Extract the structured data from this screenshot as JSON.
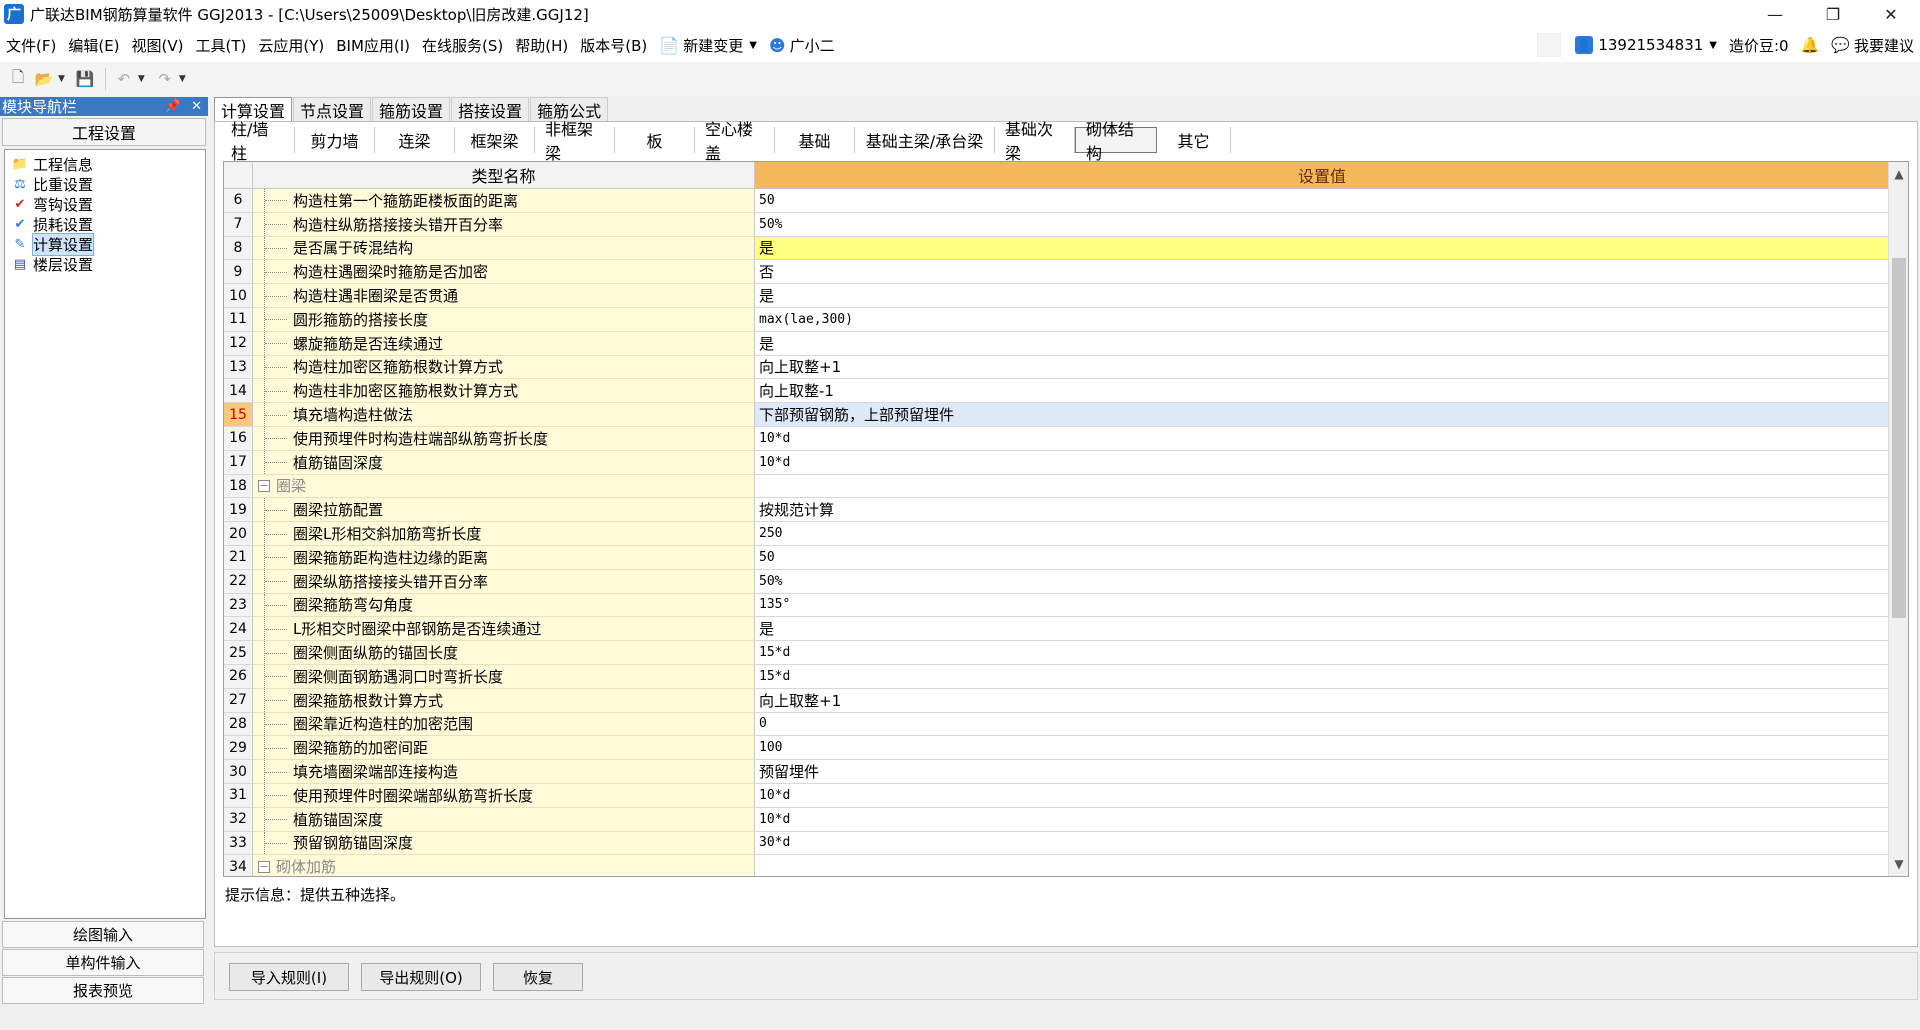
{
  "window": {
    "title": "广联达BIM钢筋算量软件 GGJ2013 - [C:\\Users\\25009\\Desktop\\旧房改建.GGJ12]",
    "app_icon": "广",
    "minimize": "—",
    "restore": "❐",
    "close": "✕"
  },
  "menu": {
    "items": [
      "文件(F)",
      "编辑(E)",
      "视图(V)",
      "工具(T)",
      "云应用(Y)",
      "BIM应用(I)",
      "在线服务(S)",
      "帮助(H)",
      "版本号(B)"
    ],
    "new_change": "新建变更",
    "assistant": "广小二",
    "account": "13921534831",
    "cost_beans": "造价豆:0",
    "feedback": "我要建议"
  },
  "nav": {
    "header": "模块导航栏",
    "section": "工程设置",
    "tree": [
      {
        "label": "工程信息",
        "icon": "folder-icon",
        "glyph": "📁"
      },
      {
        "label": "比重设置",
        "icon": "ratio-icon",
        "glyph": "⚖"
      },
      {
        "label": "弯钩设置",
        "icon": "hook-icon",
        "glyph": "✔"
      },
      {
        "label": "损耗设置",
        "icon": "loss-icon",
        "glyph": "✔"
      },
      {
        "label": "计算设置",
        "icon": "calc-settings-icon",
        "glyph": "✎"
      },
      {
        "label": "楼层设置",
        "icon": "floor-icon",
        "glyph": "▤"
      }
    ],
    "bottom": [
      "绘图输入",
      "单构件输入",
      "报表预览"
    ]
  },
  "tabs_top": [
    "计算设置",
    "节点设置",
    "箍筋设置",
    "搭接设置",
    "箍筋公式"
  ],
  "tabs_sub": [
    "柱/墙柱",
    "剪力墙",
    "连梁",
    "框架梁",
    "非框架梁",
    "板",
    "空心楼盖",
    "基础",
    "基础主梁/承台梁",
    "基础次梁",
    "砌体结构",
    "其它"
  ],
  "grid": {
    "col_name": "类型名称",
    "col_value": "设置值",
    "rows": [
      {
        "num": "6",
        "name": "构造柱第一个箍筋距楼板面的距离",
        "value": "50"
      },
      {
        "num": "7",
        "name": "构造柱纵筋搭接接头错开百分率",
        "value": "50%"
      },
      {
        "num": "8",
        "name": "是否属于砖混结构",
        "value": "是"
      },
      {
        "num": "9",
        "name": "构造柱遇圈梁时箍筋是否加密",
        "value": "否"
      },
      {
        "num": "10",
        "name": "构造柱遇非圈梁是否贯通",
        "value": "是"
      },
      {
        "num": "11",
        "name": "圆形箍筋的搭接长度",
        "value": "max(lae,300)"
      },
      {
        "num": "12",
        "name": "螺旋箍筋是否连续通过",
        "value": "是"
      },
      {
        "num": "13",
        "name": "构造柱加密区箍筋根数计算方式",
        "value": "向上取整+1"
      },
      {
        "num": "14",
        "name": "构造柱非加密区箍筋根数计算方式",
        "value": "向上取整-1"
      },
      {
        "num": "15",
        "name": "填充墙构造柱做法",
        "value": "下部预留钢筋，上部预留埋件"
      },
      {
        "num": "16",
        "name": "使用预埋件时构造柱端部纵筋弯折长度",
        "value": "10*d"
      },
      {
        "num": "17",
        "name": "植筋锚固深度",
        "value": "10*d"
      },
      {
        "num": "18",
        "name": "圈梁",
        "value": ""
      },
      {
        "num": "19",
        "name": "圈梁拉筋配置",
        "value": "按规范计算"
      },
      {
        "num": "20",
        "name": "圈梁L形相交斜加筋弯折长度",
        "value": "250"
      },
      {
        "num": "21",
        "name": "圈梁箍筋距构造柱边缘的距离",
        "value": "50"
      },
      {
        "num": "22",
        "name": "圈梁纵筋搭接接头错开百分率",
        "value": "50%"
      },
      {
        "num": "23",
        "name": "圈梁箍筋弯勾角度",
        "value": "135°"
      },
      {
        "num": "24",
        "name": "L形相交时圈梁中部钢筋是否连续通过",
        "value": "是"
      },
      {
        "num": "25",
        "name": "圈梁侧面纵筋的锚固长度",
        "value": "15*d"
      },
      {
        "num": "26",
        "name": "圈梁侧面钢筋遇洞口时弯折长度",
        "value": "15*d"
      },
      {
        "num": "27",
        "name": "圈梁箍筋根数计算方式",
        "value": "向上取整+1"
      },
      {
        "num": "28",
        "name": "圈梁靠近构造柱的加密范围",
        "value": "0"
      },
      {
        "num": "29",
        "name": "圈梁箍筋的加密间距",
        "value": "100"
      },
      {
        "num": "30",
        "name": "填充墙圈梁端部连接构造",
        "value": "预留埋件"
      },
      {
        "num": "31",
        "name": "使用预埋件时圈梁端部纵筋弯折长度",
        "value": "10*d"
      },
      {
        "num": "32",
        "name": "植筋锚固深度",
        "value": "10*d"
      },
      {
        "num": "33",
        "name": "预留钢筋锚固深度",
        "value": "30*d"
      },
      {
        "num": "34",
        "name": "砌体加筋",
        "value": ""
      }
    ]
  },
  "hint": "提示信息：提供五种选择。",
  "buttons": {
    "import": "导入规则(I)",
    "export": "导出规则(O)",
    "restore": "恢复"
  }
}
